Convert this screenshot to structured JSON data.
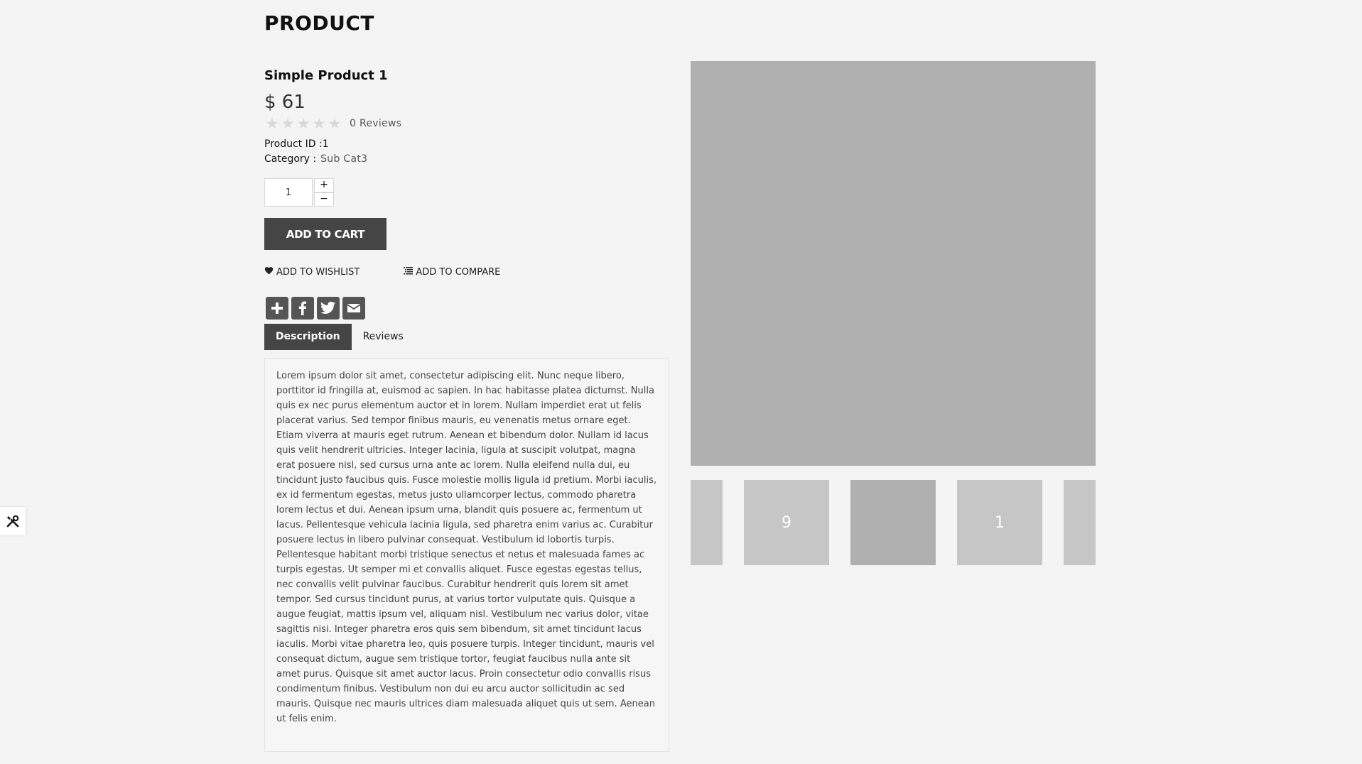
{
  "page": {
    "title": "PRODUCT"
  },
  "product": {
    "name": "Simple Product 1",
    "price": "$ 61",
    "rating": {
      "value": 0,
      "max": 5,
      "reviews_label": "0 Reviews"
    },
    "id_label": "Product ID :",
    "id_value": "1",
    "category_label": "Category :",
    "category_value": "Sub Cat3",
    "quantity": "1",
    "qty_plus": "+",
    "qty_minus": "−"
  },
  "actions": {
    "add_to_cart": "ADD TO CART",
    "wishlist": "ADD TO WISHLIST",
    "compare": "ADD TO COMPARE",
    "wishlist_icon": "heart-icon",
    "compare_icon": "list-icon"
  },
  "share": [
    {
      "icon": "add-share-icon"
    },
    {
      "icon": "facebook-icon"
    },
    {
      "icon": "twitter-icon"
    },
    {
      "icon": "email-icon"
    }
  ],
  "tabs": [
    {
      "label": "Description",
      "active": true
    },
    {
      "label": "Reviews",
      "active": false
    }
  ],
  "description": "Lorem ipsum dolor sit amet, consectetur adipiscing elit. Nunc neque libero, porttitor id fringilla at, euismod ac sapien. In hac habitasse platea dictumst. Nulla quis ex nec purus elementum auctor et in lorem. Nullam imperdiet erat ut felis placerat varius. Sed tempor finibus mauris, eu venenatis metus ornare eget. Etiam viverra at mauris eget rutrum. Aenean et bibendum dolor. Nullam id lacus quis velit hendrerit ultricies. Integer lacinia, ligula at suscipit volutpat, magna erat posuere nisl, sed cursus urna ante ac lorem. Nulla eleifend nulla dui, eu tincidunt justo faucibus quis. Fusce molestie mollis ligula id pretium. Morbi iaculis, ex id fermentum egestas, metus justo ullamcorper lectus, commodo pharetra lorem lectus et dui. Aenean ipsum urna, blandit quis posuere ac, fermentum ut lacus. Pellentesque vehicula lacinia ligula, sed pharetra enim varius ac. Curabitur posuere lectus in libero pulvinar consequat. Vestibulum id lobortis turpis. Pellentesque habitant morbi tristique senectus et netus et malesuada fames ac turpis egestas. Ut semper mi et convallis aliquet. Fusce egestas egestas tellus, nec convallis velit pulvinar faucibus. Curabitur hendrerit quis lorem sit amet tempor. Sed cursus tincidunt purus, at varius tortor vulputate quis. Quisque a augue feugiat, mattis ipsum vel, aliquam nisl. Vestibulum nec varius dolor, vitae sagittis nisi. Integer pharetra eros quis sem bibendum, sit amet tincidunt lacus iaculis. Morbi vitae pharetra leo, quis posuere turpis. Integer tincidunt, mauris vel consequat dictum, augue sem tristique tortor, feugiat faucibus nulla ante sit amet purus. Quisque sit amet auctor lacus. Proin consectetur odio convallis risus condimentum finibus. Vestibulum non dui eu arcu auctor sollicitudin ac sed mauris. Quisque nec mauris ultrices diam malesuada aliquet quis ut sem. Aenean ut felis enim.",
  "gallery": {
    "main_image_color": "#b0b0b0",
    "thumbnails": [
      {
        "label": ""
      },
      {
        "label": "9"
      },
      {
        "label": "",
        "active": true
      },
      {
        "label": "1"
      },
      {
        "label": ""
      }
    ]
  },
  "tool_icon": "tools-icon",
  "colors": {
    "button_dark": "#454545",
    "background": "#f4f4f4",
    "thumb": "#c6c6c6",
    "image_placeholder": "#b0b0b0"
  }
}
